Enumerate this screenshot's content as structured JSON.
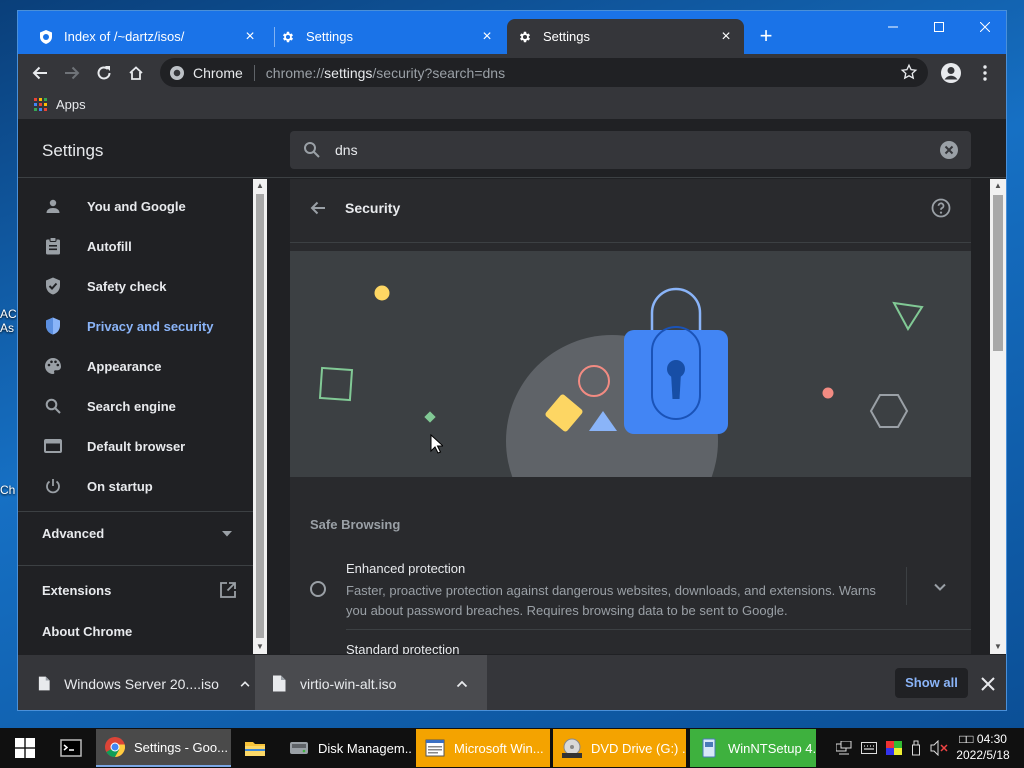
{
  "desktop": {
    "fragments": [
      "AC",
      "As",
      "Ch"
    ]
  },
  "window": {
    "tabs": [
      {
        "title": "Index of /~dartz/isos/",
        "icon": "site-favicon",
        "close": "×"
      },
      {
        "title": "Settings",
        "icon": "gear-icon",
        "close": "×"
      },
      {
        "title": "Settings",
        "icon": "gear-icon",
        "close": "×",
        "active": true
      }
    ],
    "new_tab": "+",
    "controls": [
      "minimize",
      "maximize",
      "close"
    ]
  },
  "toolbar": {
    "chip": "Chrome",
    "url_prefix": "chrome://",
    "url_host": "settings",
    "url_path": "/security?search=dns"
  },
  "bookmarks": {
    "apps_label": "Apps",
    "apps_colors": [
      "#ea4335",
      "#fbbc04",
      "#34a853",
      "#4285f4",
      "#ea4335",
      "#fbbc04",
      "#34a853",
      "#4285f4",
      "#ea4335"
    ]
  },
  "settings": {
    "title": "Settings",
    "search_value": "dns",
    "sidebar": [
      {
        "label": "You and Google",
        "icon": "person-icon"
      },
      {
        "label": "Autofill",
        "icon": "clipboard-icon"
      },
      {
        "label": "Safety check",
        "icon": "shield-check-icon"
      },
      {
        "label": "Privacy and security",
        "icon": "shield-icon",
        "selected": true
      },
      {
        "label": "Appearance",
        "icon": "palette-icon"
      },
      {
        "label": "Search engine",
        "icon": "search-icon"
      },
      {
        "label": "Default browser",
        "icon": "browser-icon"
      },
      {
        "label": "On startup",
        "icon": "power-icon"
      }
    ],
    "advanced": "Advanced",
    "extensions": "Extensions",
    "about": "About Chrome",
    "security": {
      "title": "Security",
      "section_heading": "Safe Browsing",
      "enhanced_title": "Enhanced protection",
      "enhanced_desc": "Faster, proactive protection against dangerous websites, downloads, and extensions. Warns you about password breaches. Requires browsing data to be sent to Google.",
      "standard_title": "Standard protection"
    }
  },
  "downloads": {
    "items": [
      {
        "name": "Windows Server 20....iso"
      },
      {
        "name": "virtio-win-alt.iso"
      }
    ],
    "show_all": "Show all"
  },
  "taskbar": {
    "apps": [
      {
        "label": "",
        "icon": "terminal-icon"
      },
      {
        "label": "Settings - Goo...",
        "icon": "chrome-icon",
        "active": true
      },
      {
        "label": "",
        "icon": "folder-icon"
      },
      {
        "label": "Disk Managem...",
        "icon": "disk-management-icon"
      },
      {
        "label": "Microsoft Win...",
        "icon": "window-app-icon",
        "highlight": "yellow"
      },
      {
        "label": "DVD Drive (G:) ...",
        "icon": "dvd-icon",
        "highlight": "yellow"
      },
      {
        "label": "WinNTSetup 4....",
        "icon": "setup-icon",
        "highlight": "green"
      }
    ],
    "clock_time": "04:30",
    "clock_prefix": "□□",
    "clock_date": "2022/5/18"
  }
}
